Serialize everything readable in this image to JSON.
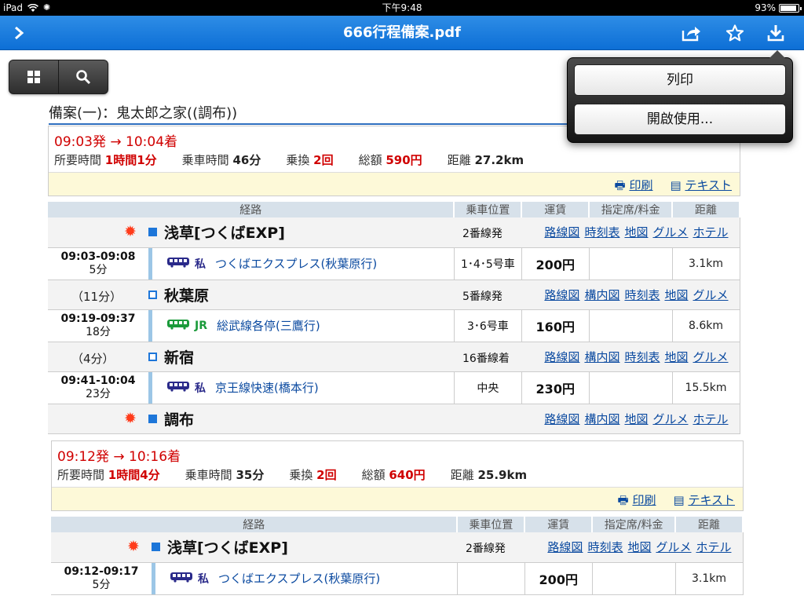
{
  "status": {
    "device": "iPad",
    "time": "下午9:48",
    "battery": "93%"
  },
  "nav": {
    "title": "666行程備案.pdf"
  },
  "popover": {
    "print": "列印",
    "open_in": "開啟使用..."
  },
  "doc": {
    "title": "備案(一)：鬼太郎之家((調布))",
    "headers": [
      "経路",
      "乗車位置",
      "運賃",
      "指定席/料金",
      "距離"
    ],
    "labels": {
      "duration": "所要時間",
      "ride": "乗車時間",
      "transfer": "乗換",
      "total": "総額",
      "distance": "距離",
      "print": "印刷",
      "text": "テキスト"
    },
    "routes": [
      {
        "times": "09:03発 → 10:04着",
        "duration": "1時間1分",
        "ride": "46分",
        "transfer": "2回",
        "total": "590円",
        "distance": "27.2km",
        "rows": [
          {
            "kind": "station",
            "name": "浅草[つくばEXP]",
            "platform": "2番線発",
            "links": [
              "路線図",
              "時刻表",
              "地図",
              "グルメ",
              "ホテル"
            ],
            "mark": "sun"
          },
          {
            "kind": "ride",
            "time": "09:03-09:08",
            "dur": "5分",
            "op": "私",
            "line": "つくばエクスプレス(秋葉原行)",
            "pos": "1･4･5号車",
            "fare": "200円",
            "dist": "3.1km"
          },
          {
            "kind": "station",
            "gap": "（11分）",
            "name": "秋葉原",
            "platform": "5番線発",
            "links": [
              "路線図",
              "構内図",
              "時刻表",
              "地図",
              "グルメ"
            ],
            "mark": "open"
          },
          {
            "kind": "ride",
            "time": "09:19-09:37",
            "dur": "18分",
            "op": "JR",
            "line": "総武線各停(三鷹行)",
            "pos": "3･6号車",
            "fare": "160円",
            "dist": "8.6km"
          },
          {
            "kind": "station",
            "gap": "（4分）",
            "name": "新宿",
            "platform": "16番線着",
            "links": [
              "路線図",
              "構内図",
              "時刻表",
              "地図",
              "グルメ"
            ],
            "mark": "open"
          },
          {
            "kind": "ride",
            "time": "09:41-10:04",
            "dur": "23分",
            "op": "私",
            "line": "京王線快速(橋本行)",
            "pos": "中央",
            "fare": "230円",
            "dist": "15.5km"
          },
          {
            "kind": "station",
            "name": "調布",
            "platform": "",
            "links": [
              "路線図",
              "構内図",
              "地図",
              "グルメ",
              "ホテル"
            ],
            "mark": "sun"
          }
        ]
      },
      {
        "times": "09:12発 → 10:16着",
        "duration": "1時間4分",
        "ride": "35分",
        "transfer": "2回",
        "total": "640円",
        "distance": "25.9km",
        "rows": [
          {
            "kind": "station",
            "name": "浅草[つくばEXP]",
            "platform": "2番線発",
            "links": [
              "路線図",
              "時刻表",
              "地図",
              "グルメ",
              "ホテル"
            ],
            "mark": "sun"
          },
          {
            "kind": "ride",
            "time": "09:12-09:17",
            "dur": "5分",
            "op": "私",
            "line": "つくばエクスプレス(秋葉原行)",
            "pos": "",
            "fare": "200円",
            "dist": "3.1km"
          }
        ]
      }
    ]
  }
}
